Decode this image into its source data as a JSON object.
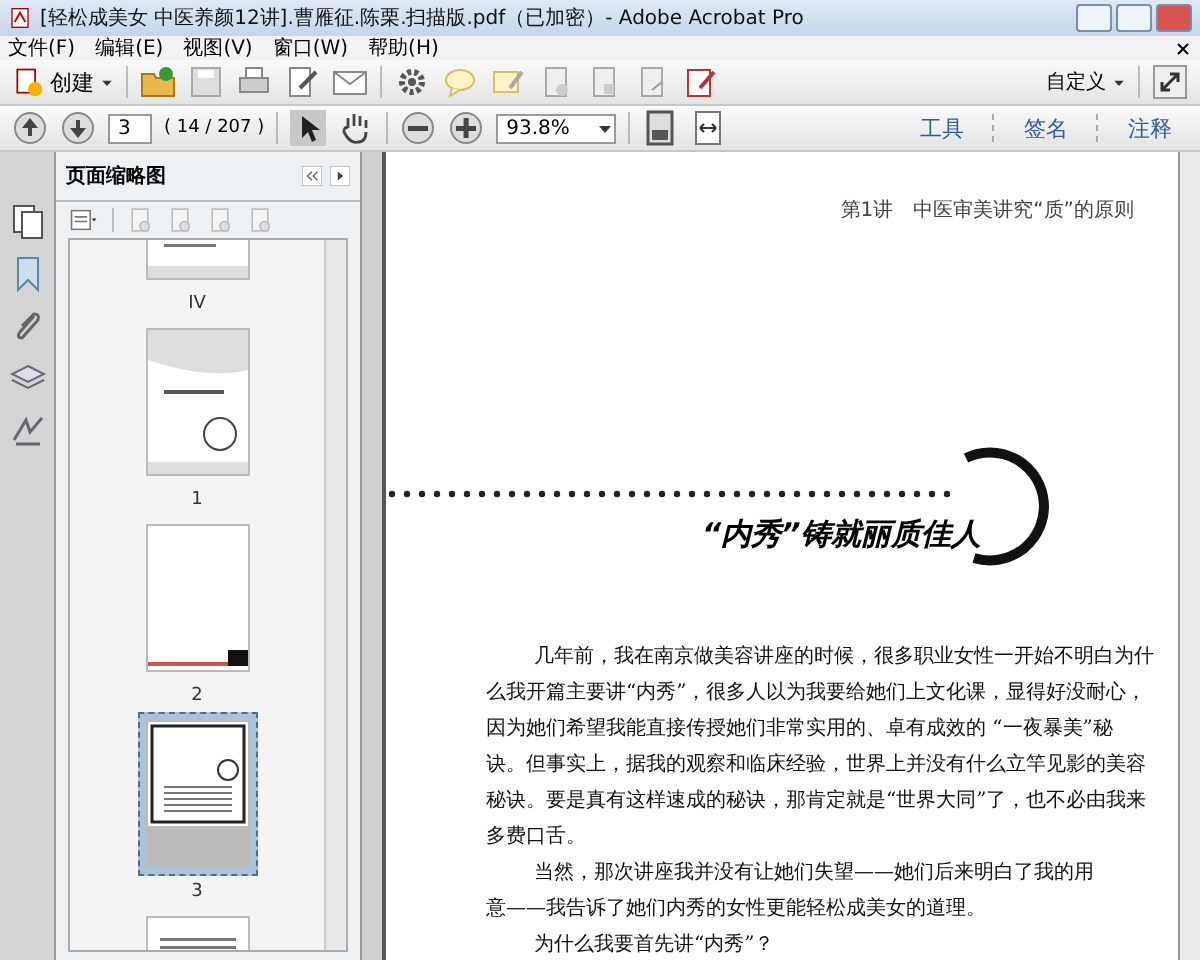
{
  "window": {
    "title": "[轻松成美女 中医养颜12讲].曹雁征.陈栗.扫描版.pdf（已加密）- Adobe Acrobat Pro"
  },
  "menu": [
    "文件(F)",
    "编辑(E)",
    "视图(V)",
    "窗口(W)",
    "帮助(H)"
  ],
  "toolbar": {
    "create": "创建",
    "customize": "自定义"
  },
  "nav": {
    "page": "3",
    "page_count": "( 14 / 207 )",
    "zoom": "93.8%"
  },
  "task_tabs": [
    {
      "label": "工具"
    },
    {
      "label": "签名"
    },
    {
      "label": "注释"
    }
  ],
  "side_panel": {
    "title": "页面缩略图",
    "thumbnails": [
      {
        "kind": "toc",
        "label": "IV",
        "selected": false
      },
      {
        "kind": "cover",
        "label": "1",
        "selected": false
      },
      {
        "kind": "blank",
        "label": "2",
        "selected": false
      },
      {
        "kind": "chapter",
        "label": "3",
        "selected": true
      },
      {
        "kind": "text",
        "selected": false
      }
    ]
  },
  "page": {
    "running_head": "第1讲　中医审美讲究“质”的原则",
    "heading": "“内秀”铸就丽质佳人",
    "paragraphs": [
      {
        "lines": [
          "几年前，我在南京做美容讲座的时候，很多职业女性一开始不明白为什",
          "么我开篇主要讲“内秀”，很多人以为我要给她们上文化课，显得好没耐心，",
          "因为她们希望我能直接传授她们非常实用的、卓有成效的 “一夜暴美”秘",
          "诀。但事实上，据我的观察和临床经验，世界上并没有什么立竿见影的美容",
          "秘诀。要是真有这样速成的秘诀，那肯定就是“世界大同”了，也不必由我来",
          "多费口舌。"
        ]
      },
      {
        "lines": [
          "当然，那次讲座我并没有让她们失望——她们后来明白了我的用",
          "意——我告诉了她们内秀的女性更能轻松成美女的道理。"
        ]
      },
      {
        "lines": [
          "为什么我要首先讲“内秀”？"
        ]
      }
    ]
  }
}
